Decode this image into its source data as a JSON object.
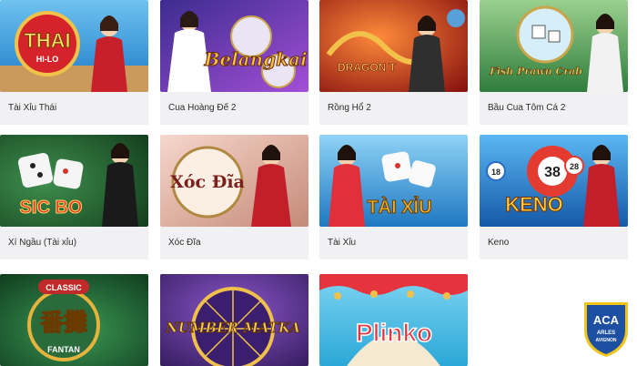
{
  "games": [
    {
      "name": "Tài Xỉu Thái",
      "logo": "THAI",
      "logo_sub": "HI-LO",
      "theme": "#1a78c6",
      "accent": "#e8b23a"
    },
    {
      "name": "Cua Hoàng Đế 2",
      "logo": "Belangkai",
      "theme": "#7a3fbf",
      "accent": "#f6c244"
    },
    {
      "name": "Rồng Hổ 2",
      "logo": "DRAGON T",
      "theme": "#b3221c",
      "accent": "#f2c14a"
    },
    {
      "name": "Bầu Cua Tôm Cá 2",
      "logo": "Fish Prawn Crab",
      "theme": "#3c8e4a",
      "accent": "#f4d35e"
    },
    {
      "name": "Xí Ngầu (Tài xỉu)",
      "logo": "SIC BO",
      "theme": "#1f5b2c",
      "accent": "#d8332b"
    },
    {
      "name": "Xóc Đĩa",
      "logo": "Xóc Đĩa",
      "theme": "#e7b6a8",
      "accent": "#7a1f1a"
    },
    {
      "name": "Tài Xỉu",
      "logo": "TÀI XỈU",
      "theme": "#2b93d6",
      "accent": "#f0b429"
    },
    {
      "name": "Keno",
      "logo": "KENO",
      "theme": "#1e7bd4",
      "accent": "#e33b2f"
    },
    {
      "name": "",
      "logo": "FANTAN",
      "logo_top": "CLASSIC",
      "theme": "#1f6b36",
      "accent": "#e6b33c"
    },
    {
      "name": "",
      "logo": "NUMBER MATKA",
      "theme": "#5b2d8f",
      "accent": "#f0c04b"
    },
    {
      "name": "",
      "logo": "Plinko",
      "theme": "#2aa8d8",
      "accent": "#e5343d"
    }
  ],
  "badge": {
    "line1": "ACA",
    "line2": "ARLES",
    "line3": "AVIGNON",
    "color": "#1d4fa3",
    "accent": "#f0c419"
  }
}
